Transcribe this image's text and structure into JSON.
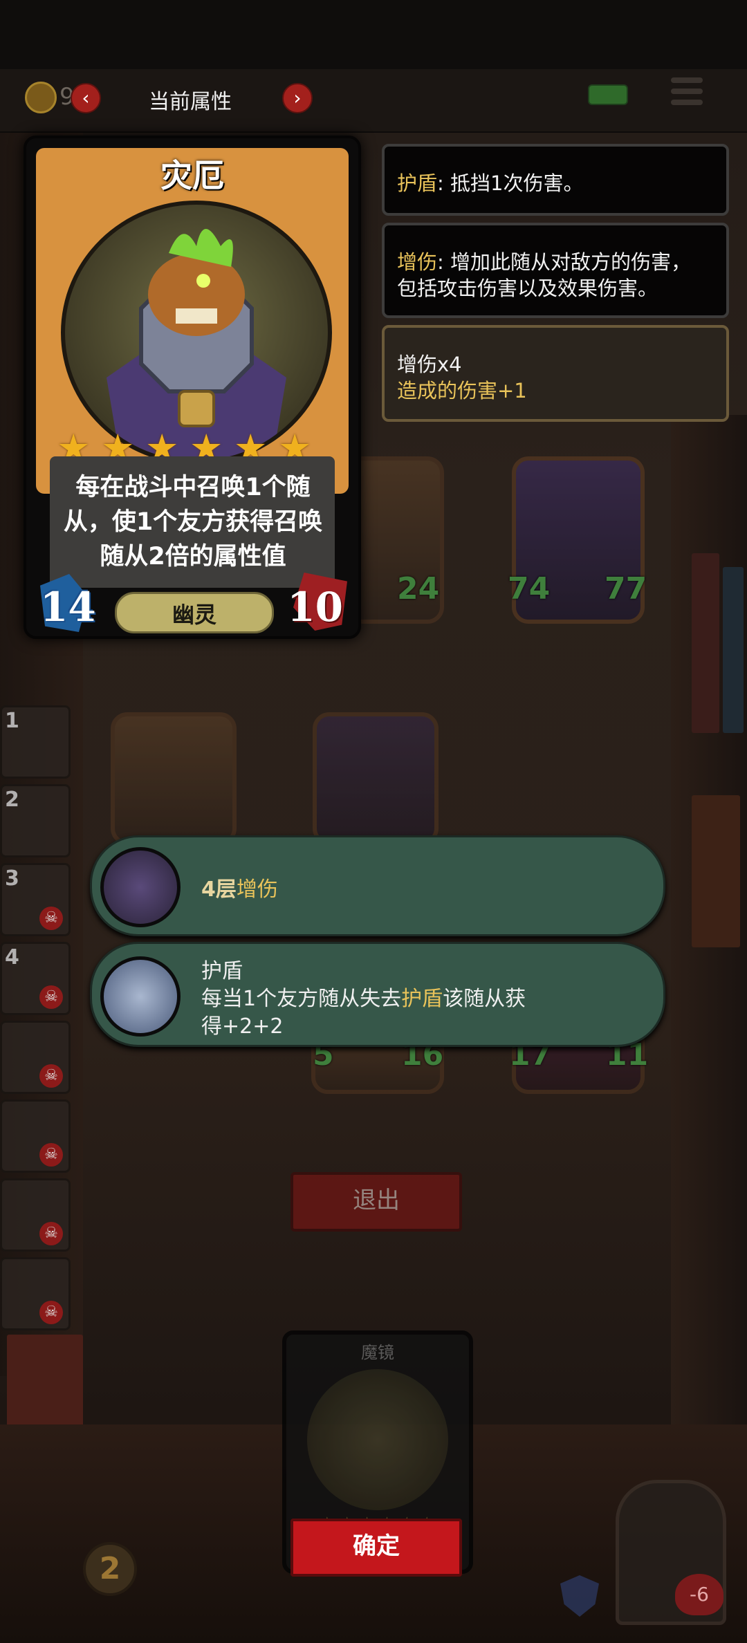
{
  "top_bar": {
    "title": "当前属性",
    "coin_value": "9",
    "prev_icon": "chevron-left-icon",
    "next_icon": "chevron-right-icon"
  },
  "selected_card": {
    "name": "灾厄",
    "stars": 6,
    "description": "每在战斗中召唤1个随从，使1个友方获得召唤随从2倍的属性值",
    "attack": "14",
    "health": "10",
    "tribe": "幽灵"
  },
  "info_boxes": [
    {
      "keyword": "护盾",
      "text": ": 抵挡1次伤害。"
    },
    {
      "keyword": "增伤",
      "text": ": 增加此随从对敌方的伤害，",
      "text2": "包括攻击伤害以及效果伤害。"
    },
    {
      "title": "增伤x4",
      "text": "造成的伤害+1"
    }
  ],
  "board_stats": [
    "24",
    "74",
    "77",
    "5",
    "16",
    "17",
    "11"
  ],
  "roster_numbers": [
    "1",
    "2",
    "3",
    "4"
  ],
  "effects": [
    {
      "prefix": "4层",
      "keyword": "增伤"
    },
    {
      "title": "护盾",
      "line1_a": "每当1个友方随从失去",
      "line1_keyword": "护盾",
      "line1_b": "该随从获",
      "line2": "得+2+2"
    }
  ],
  "buttons": {
    "exit": "退出",
    "confirm": "确定"
  },
  "hand_card": {
    "label": "魔镜",
    "stars": "★★★★★★"
  },
  "tavern_level": "2",
  "hero_hp": "-6",
  "colors": {
    "accent_red": "#c4171c",
    "keyword_gold": "#e9c35a",
    "effect_panel": "#365749"
  }
}
